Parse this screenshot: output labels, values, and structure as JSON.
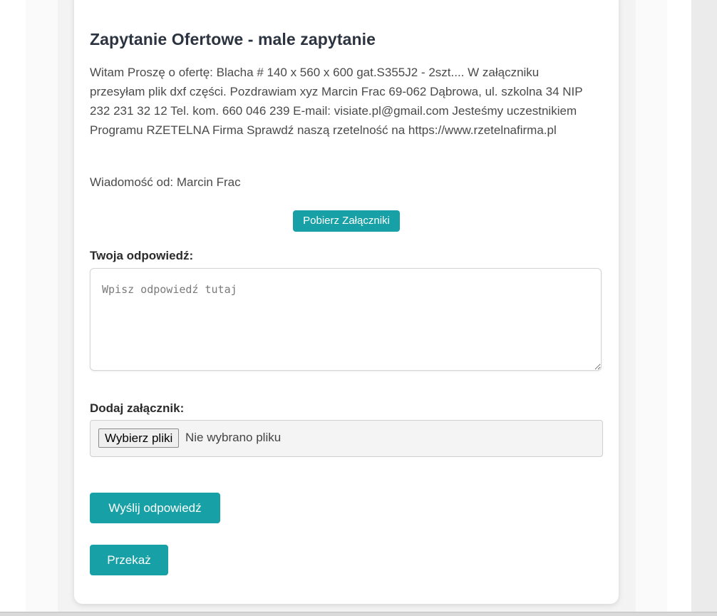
{
  "inquiry": {
    "title": "Zapytanie Ofertowe - male zapytanie",
    "message": "Witam Proszę o ofertę: Blacha # 140 x 560 x 600 gat.S355J2 - 2szt.... W załączniku przesyłam plik dxf części. Pozdrawiam xyz Marcin Frac 69-062 Dąbrowa, ul. szkolna 34 NIP 232 231 32 12 Tel. kom. 660 046 239 E-mail: visiate.pl@gmail.com Jesteśmy uczestnikiem Programu RZETELNA Firma Sprawdź naszą rzetelność na https://www.rzetelnafirma.pl",
    "sender": "Wiadomość od: Marcin Frac",
    "download_label": "Pobierz Załączniki"
  },
  "reply": {
    "label": "Twoja odpowiedź:",
    "placeholder": "Wpisz odpowiedź tutaj",
    "value": ""
  },
  "attachment": {
    "label": "Dodaj załącznik:",
    "button_label": "Wybierz pliki",
    "status": "Nie wybrano pliku"
  },
  "actions": {
    "send_label": "Wyślij odpowiedź",
    "forward_label": "Przekaż"
  },
  "colors": {
    "accent": "#17a1a7",
    "title": "#2b3440",
    "text": "#4a4a4a"
  }
}
